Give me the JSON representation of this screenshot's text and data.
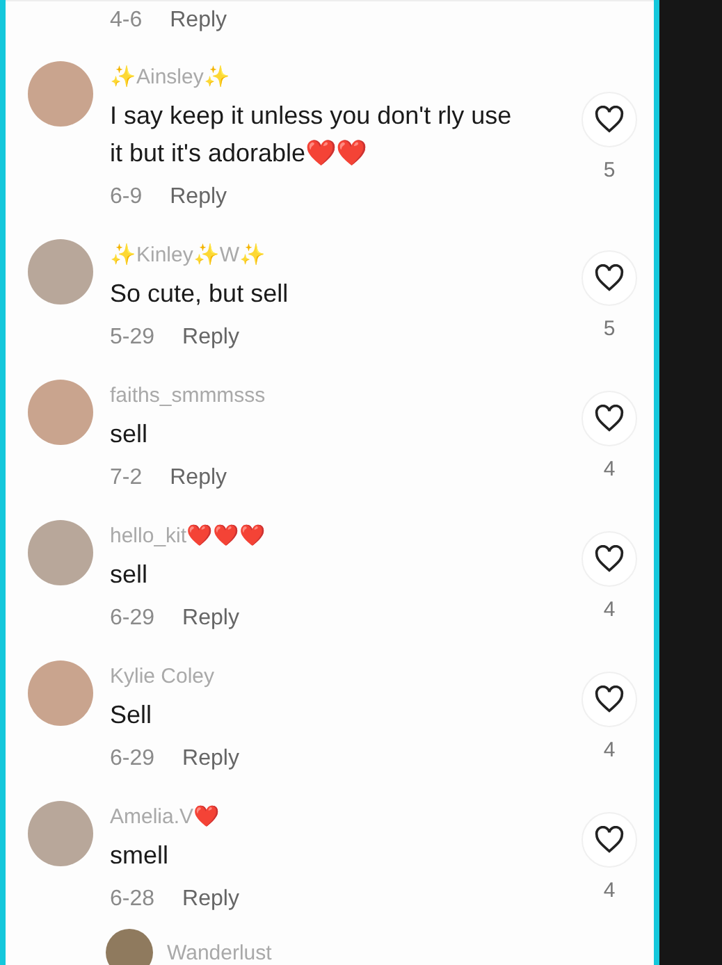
{
  "top_row": {
    "date": "4-6",
    "reply": "Reply"
  },
  "comments": [
    {
      "kind": "comment",
      "username": "✨Ainsley✨",
      "text": "I say keep it unless you don't rly use it but it's adorable❤️❤️",
      "date": "6-9",
      "reply": "Reply",
      "likes": "5"
    },
    {
      "kind": "comment",
      "username": "✨Kinley✨W✨",
      "text": "So cute, but sell",
      "date": "5-29",
      "reply": "Reply",
      "likes": "5"
    },
    {
      "kind": "comment",
      "username": "faiths_smmmsss",
      "text": "sell",
      "date": "7-2",
      "reply": "Reply",
      "likes": "4"
    },
    {
      "kind": "comment",
      "username": "hello_kit❤️❤️❤️",
      "text": "sell",
      "date": "6-29",
      "reply": "Reply",
      "likes": "4"
    },
    {
      "kind": "comment",
      "username": "Kylie Coley",
      "text": "Sell",
      "date": "6-29",
      "reply": "Reply",
      "likes": "4"
    },
    {
      "kind": "comment",
      "username": "Amelia.V❤️",
      "text": "smell",
      "date": "6-28",
      "reply": "Reply",
      "likes": "4"
    },
    {
      "kind": "reply",
      "username": "Wanderlust"
    }
  ]
}
